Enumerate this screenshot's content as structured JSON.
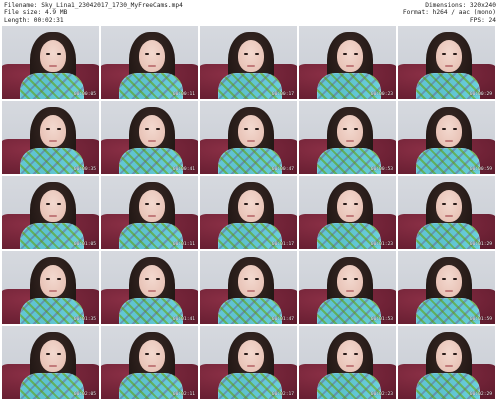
{
  "header": {
    "filename": "Filename: Sky_Lina1_23042017_1730_MyFreeCams.mp4",
    "filesize": "File size: 4.9 MB",
    "length": "Length: 00:02:31",
    "dimensions": "Dimensions: 320x240",
    "format": "Format: h264 / aac (mono)",
    "fps": "FPS: 24"
  },
  "thumbnails": [
    {
      "timestamp": "00:00:05"
    },
    {
      "timestamp": "00:00:11"
    },
    {
      "timestamp": "00:00:17"
    },
    {
      "timestamp": "00:00:23"
    },
    {
      "timestamp": "00:00:29"
    },
    {
      "timestamp": "00:00:35"
    },
    {
      "timestamp": "00:00:41"
    },
    {
      "timestamp": "00:00:47"
    },
    {
      "timestamp": "00:00:53"
    },
    {
      "timestamp": "00:00:59"
    },
    {
      "timestamp": "00:01:05"
    },
    {
      "timestamp": "00:01:11"
    },
    {
      "timestamp": "00:01:17"
    },
    {
      "timestamp": "00:01:23"
    },
    {
      "timestamp": "00:01:29"
    },
    {
      "timestamp": "00:01:35"
    },
    {
      "timestamp": "00:01:41"
    },
    {
      "timestamp": "00:01:47"
    },
    {
      "timestamp": "00:01:53"
    },
    {
      "timestamp": "00:01:59"
    },
    {
      "timestamp": "00:02:05"
    },
    {
      "timestamp": "00:02:11"
    },
    {
      "timestamp": "00:02:17"
    },
    {
      "timestamp": "00:02:23"
    },
    {
      "timestamp": "00:02:29"
    }
  ]
}
